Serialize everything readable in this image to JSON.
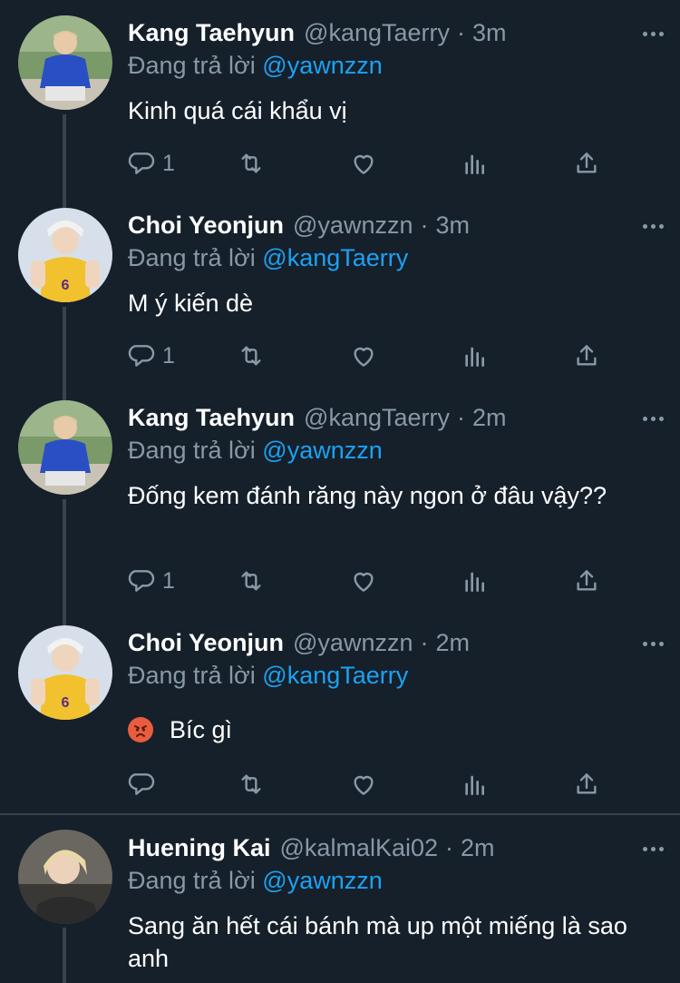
{
  "tweets": [
    {
      "name": "Kang Taehyun",
      "handle": "@kangTaerry",
      "time": "3m",
      "reply_prefix": "Đang trả lời",
      "reply_to": "@yawnzzn",
      "text": "Kinh quá cái khẩu vị",
      "reply_count": "1",
      "avatar": "avatar-blue-hoodie"
    },
    {
      "name": "Choi Yeonjun",
      "handle": "@yawnzzn",
      "time": "3m",
      "reply_prefix": "Đang trả lời",
      "reply_to": "@kangTaerry",
      "text": "M ý kiến dè",
      "reply_count": "1",
      "avatar": "avatar-yellow-jersey"
    },
    {
      "name": "Kang Taehyun",
      "handle": "@kangTaerry",
      "time": "2m",
      "reply_prefix": "Đang trả lời",
      "reply_to": "@yawnzzn",
      "text": "Đống kem đánh răng này ngon ở đâu vậy??",
      "reply_count": "1",
      "avatar": "avatar-blue-hoodie"
    },
    {
      "name": "Choi Yeonjun",
      "handle": "@yawnzzn",
      "time": "2m",
      "reply_prefix": "Đang trả lời",
      "reply_to": "@kangTaerry",
      "text": "Bíc gì",
      "emoji": "angry-face-icon",
      "reply_count": "",
      "avatar": "avatar-yellow-jersey"
    },
    {
      "name": "Huening Kai",
      "handle": "@kalmalKai02",
      "time": "2m",
      "reply_prefix": "Đang trả lời",
      "reply_to": "@yawnzzn",
      "text": "Sang ăn hết cái bánh mà up một miếng là sao anh",
      "reply_count": "",
      "avatar": "avatar-blonde"
    }
  ],
  "separator_symbol": "·",
  "colors": {
    "background": "#15202b",
    "secondary_text": "#8899a6",
    "mention": "#1da1f2",
    "divider": "#38444d"
  }
}
